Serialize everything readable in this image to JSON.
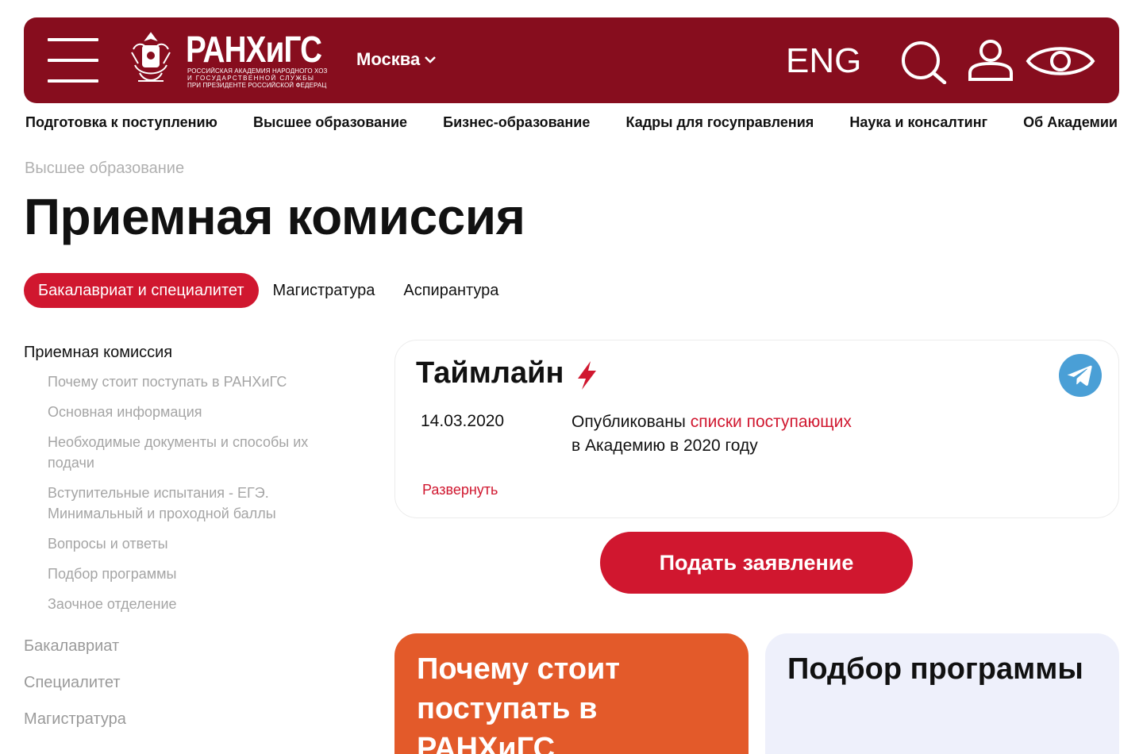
{
  "header": {
    "logo_title": "РАНХиГС",
    "logo_subtitle_lines": [
      "Российская академия народного хозяйства",
      "и государственной службы",
      "при президенте российской федерации"
    ],
    "city": "Москва",
    "lang": "ENG",
    "icons": [
      "menu-icon",
      "emblem-logo",
      "chevron-down-icon",
      "search-icon",
      "user-icon",
      "eye-icon"
    ],
    "color": "#870d1e"
  },
  "nav": [
    "Подготовка к поступлению",
    "Высшее образование",
    "Бизнес-образование",
    "Кадры для госуправления",
    "Наука и консалтинг",
    "Об Академии"
  ],
  "breadcrumb": "Высшее образование",
  "page_title": "Приемная комиссия",
  "tabs": [
    {
      "label": "Бакалавриат и специалитет",
      "active": true
    },
    {
      "label": "Магистратура",
      "active": false
    },
    {
      "label": "Аспирантура",
      "active": false
    }
  ],
  "sidebar": {
    "heading": "Приемная комиссия",
    "items": [
      "Почему стоит поступать в РАНХиГС",
      "Основная информация",
      "Необходимые документы и способы их подачи",
      "Вступительные испытания - ЕГЭ. Минимальный и проходной баллы",
      "Вопросы и ответы",
      "Подбор программы",
      "Заочное отделение"
    ],
    "sections": [
      "Бакалавриат",
      "Специалитет",
      "Магистратура"
    ]
  },
  "timeline": {
    "title": "Таймлайн",
    "date": "14.03.2020",
    "text_before": "Опубликованы ",
    "link_text": "списки поступающих",
    "text_after": "в Академию в 2020 году",
    "expand": "Развернуть",
    "icons": [
      "lightning-icon",
      "telegram-icon"
    ]
  },
  "apply_button": "Подать заявление",
  "cards": {
    "why": "Почему стоит поступать в РАНХиГС",
    "select": "Подбор программы"
  },
  "colors": {
    "accent": "#d0172f",
    "header_bg": "#870d1e",
    "orange_card": "#e35a2a",
    "grey_card": "#eef0fb",
    "telegram": "#4a9fd6"
  }
}
